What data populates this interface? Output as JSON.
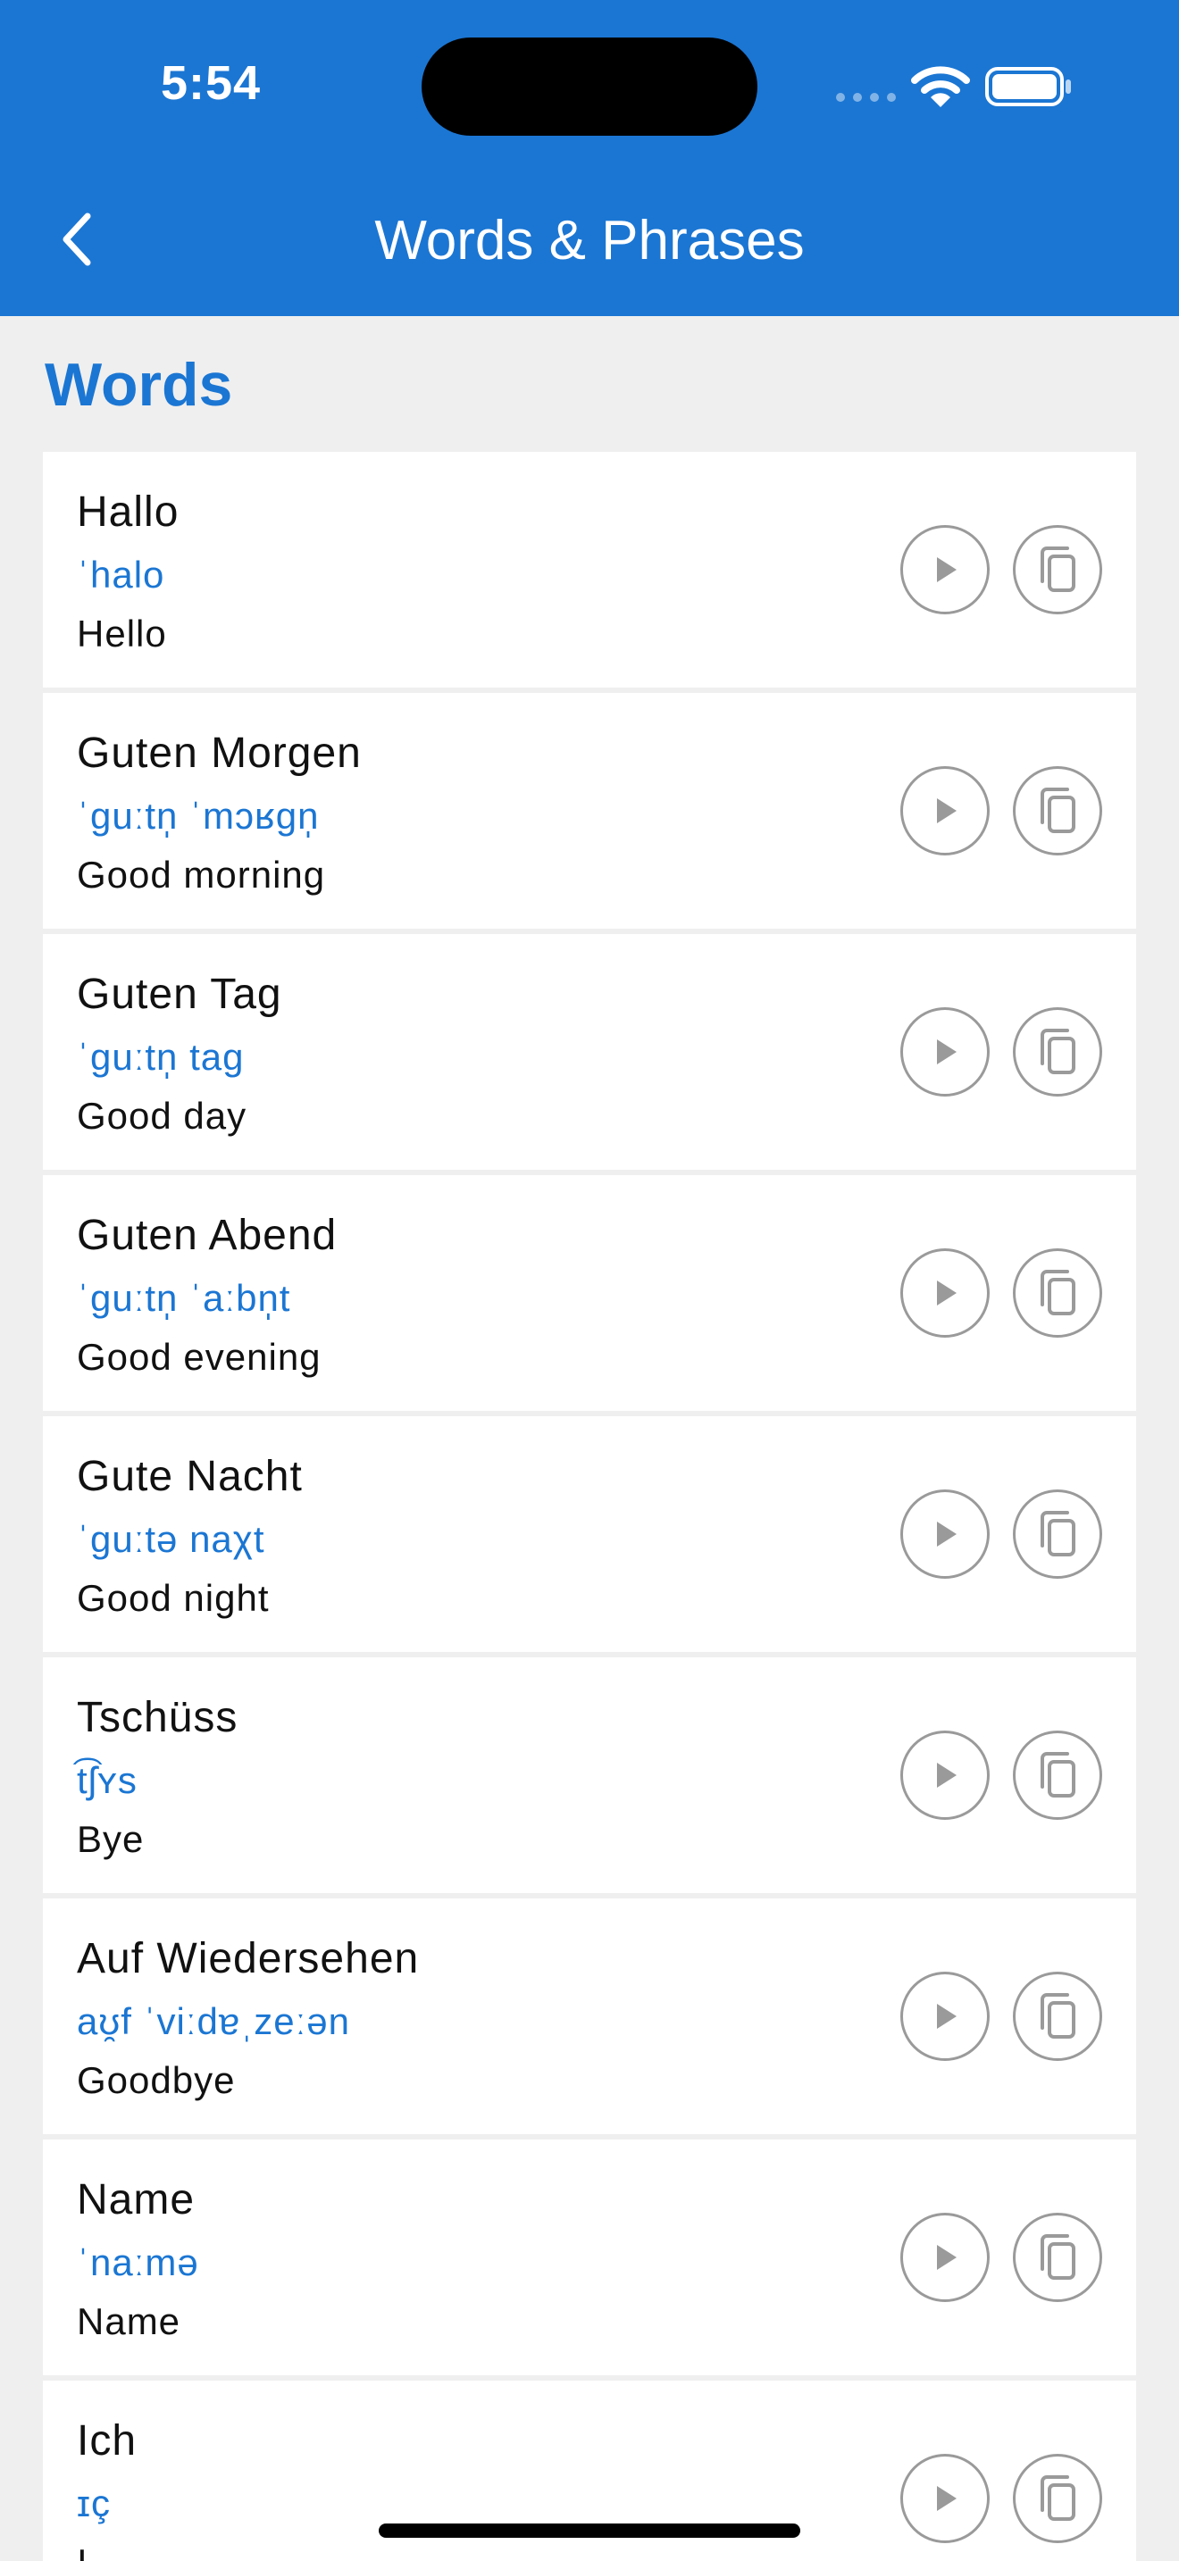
{
  "status_bar": {
    "time": "5:54"
  },
  "nav": {
    "title": "Words & Phrases"
  },
  "section": {
    "title": "Words"
  },
  "words": [
    {
      "word": "Hallo",
      "ipa": "ˈhalo",
      "translation": "Hello"
    },
    {
      "word": "Guten Morgen",
      "ipa": "ˈɡuːtn̩ ˈmɔʁɡn̩",
      "translation": "Good morning"
    },
    {
      "word": "Guten Tag",
      "ipa": "ˈɡuːtn̩ taɡ",
      "translation": "Good day"
    },
    {
      "word": "Guten Abend",
      "ipa": "ˈɡuːtn̩ ˈaːbn̩t",
      "translation": "Good evening"
    },
    {
      "word": "Gute Nacht",
      "ipa": "ˈɡuːtə naχt",
      "translation": "Good night"
    },
    {
      "word": "Tschüss",
      "ipa": "t͡ʃʏs",
      "translation": "Bye"
    },
    {
      "word": "Auf Wiedersehen",
      "ipa": "aʊ̯f ˈviːdɐˌzeːən",
      "translation": "Goodbye"
    },
    {
      "word": "Name",
      "ipa": "ˈnaːmə",
      "translation": "Name"
    },
    {
      "word": "Ich",
      "ipa": "ɪç",
      "translation": "I"
    }
  ],
  "icons": {
    "back": "chevron-left-icon",
    "play": "play-icon",
    "copy": "copy-icon",
    "wifi": "wifi-icon",
    "battery": "battery-icon"
  },
  "colors": {
    "header": "#1b76d3",
    "accent": "#1b76d3",
    "background": "#efefef",
    "card": "#ffffff",
    "icon_gray": "#9a9a9a"
  }
}
